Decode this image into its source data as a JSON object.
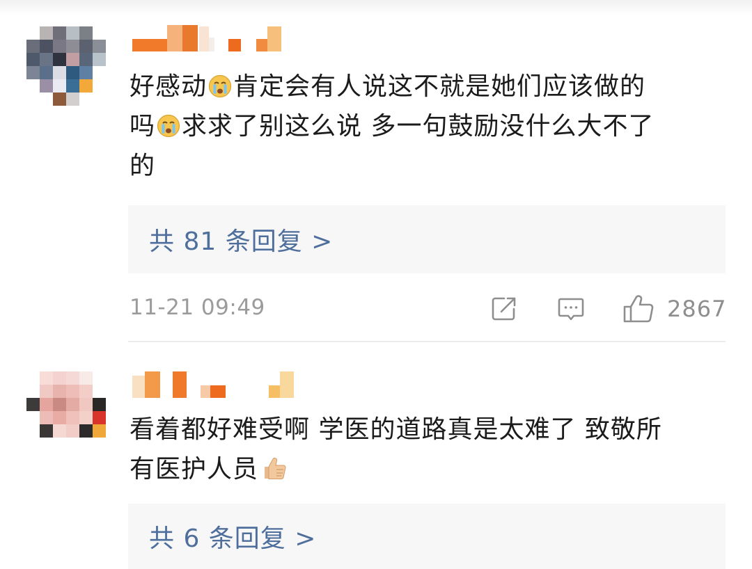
{
  "comments": [
    {
      "text_line1": "好感动",
      "text_line1b": "肯定会有人说这不就是她们应该做的",
      "text_line2": "吗",
      "text_line2b": "求求了别这么说 多一句鼓励没什么大不了",
      "text_line3": "的",
      "emoji": "crying-face-icon",
      "replies_label": "共 81 条回复 >",
      "timestamp": "11-21 09:49",
      "like_count": "2867",
      "icons": [
        "share-icon",
        "comment-icon",
        "like-icon"
      ]
    },
    {
      "text_line1": "看着都好难受啊 学医的道路真是太难了 致敬所",
      "text_line2": "有医护人员",
      "emoji": "thumbs-up-icon",
      "replies_label": "共 6 条回复 >"
    }
  ],
  "colors": {
    "link": "#4e6e9c",
    "meta": "#9b9b9b",
    "reply_bg": "#f7f7f7",
    "username_orange": "#f07a2a"
  }
}
